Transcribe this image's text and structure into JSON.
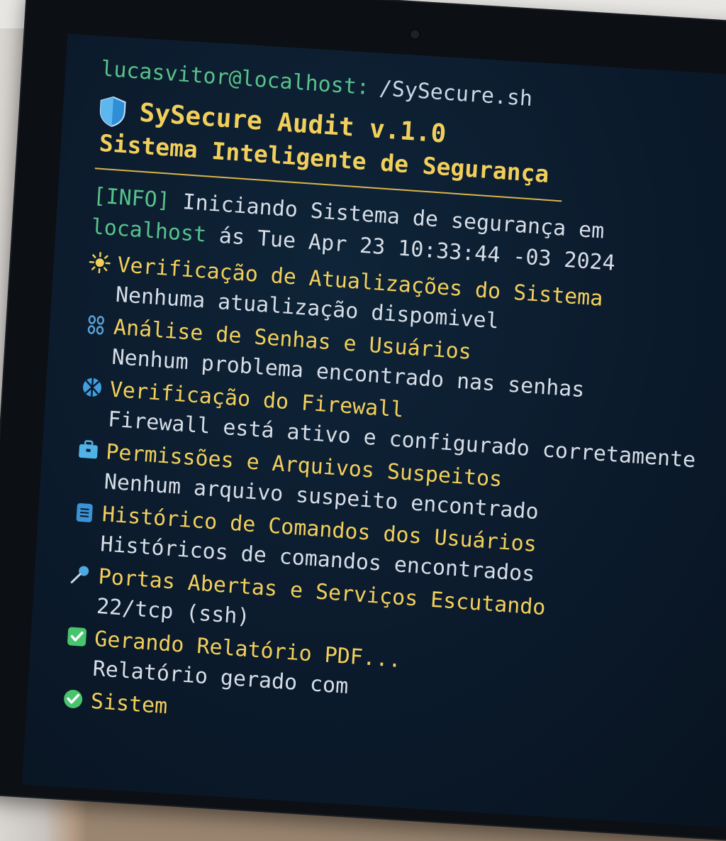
{
  "terminal": {
    "prompt_user": "lucasvitor@localhost:",
    "prompt_path": "/SySecure.sh",
    "title": "SySecure Audit v.1.0",
    "subtitle": "Sistema Inteligente de Segurança",
    "info_tag": "[INFO]",
    "info_text_1": "Iniciando Sistema de segurança em",
    "info_host": "localhost",
    "info_text_2": "ás Tue Apr 23 10:33:44 -03 2024"
  },
  "sections": [
    {
      "title": "Verificação de Atualizações do Sistema",
      "detail": "Nenhuma atualização dispomivel",
      "icon": "sun-icon"
    },
    {
      "title": "Análise de Senhas e Usuários",
      "detail": "Nenhum problema encontrado nas senhas",
      "icon": "users-icon"
    },
    {
      "title": "Verificação do Firewall",
      "detail": "Firewall está ativo e configurado corretamente",
      "icon": "firewall-icon"
    },
    {
      "title": "Permissões e Arquivos Suspeitos",
      "detail": "Nenhum arquivo suspeito encontrado",
      "icon": "briefcase-icon"
    },
    {
      "title": "Histórico de Comandos dos Usuários",
      "detail": "Históricos de comandos encontrados",
      "icon": "clipboard-icon"
    },
    {
      "title": "Portas Abertas e Serviços Escutando",
      "detail": "22/tcp (ssh)",
      "icon": "pin-icon"
    },
    {
      "title": "Gerando Relatório PDF...",
      "detail": "Relatório gerado com",
      "icon": "checkbox-icon"
    },
    {
      "title": "Sistem",
      "detail": "",
      "icon": "check-circle-icon"
    }
  ],
  "colors": {
    "accent": "#f2cf5b",
    "prompt": "#58c28a",
    "text": "#d6dde6",
    "background": "#0b1a2b"
  }
}
